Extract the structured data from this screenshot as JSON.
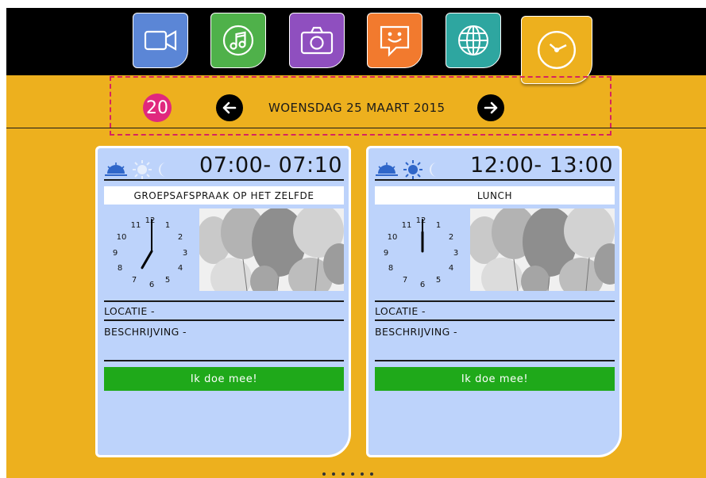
{
  "apps": [
    {
      "name": "video",
      "icon": "video-camera-icon",
      "color": "#5b86d6"
    },
    {
      "name": "music",
      "icon": "music-note-icon",
      "color": "#4fb14a"
    },
    {
      "name": "photo",
      "icon": "camera-icon",
      "color": "#8f4fbf"
    },
    {
      "name": "chat",
      "icon": "chat-smiley-icon",
      "color": "#f27a2e"
    },
    {
      "name": "web",
      "icon": "globe-icon",
      "color": "#2ea6a0"
    },
    {
      "name": "clock",
      "icon": "clock-icon",
      "color": "#edb01e",
      "active": true
    }
  ],
  "date_header": {
    "day_number": "20",
    "date_label": "WOENSDAG 25 MAART 2015",
    "prev_icon": "arrow-left-icon",
    "next_icon": "arrow-right-icon",
    "highlight_color": "#d6245f"
  },
  "cards": [
    {
      "time": "07:00- 07:10",
      "title": "GROEPSAFSPRAAK OP HET ZELFDE",
      "clock": {
        "hour": 7,
        "minute": 0
      },
      "weather": {
        "active": "sunrise",
        "icons": [
          "sunrise-icon",
          "sun-icon",
          "moon-icon"
        ]
      },
      "location_label": "LOCATIE -",
      "description_label": "BESCHRIJVING -",
      "join_label": "Ik doe mee!",
      "image": "balloons-photo"
    },
    {
      "time": "12:00- 13:00",
      "title": "LUNCH",
      "clock": {
        "hour": 12,
        "minute": 0
      },
      "weather": {
        "active": "sun",
        "icons": [
          "sunrise-icon",
          "sun-icon",
          "moon-icon"
        ]
      },
      "location_label": "LOCATIE -",
      "description_label": "BESCHRIJVING -",
      "join_label": "Ik doe mee!",
      "image": "balloons-photo"
    }
  ],
  "clock_numbers": [
    "12",
    "1",
    "2",
    "3",
    "4",
    "5",
    "6",
    "7",
    "8",
    "9",
    "10",
    "11"
  ],
  "pagination": {
    "pages": 6,
    "current": 1
  },
  "colors": {
    "background": "#edb01e",
    "topbar": "#000000",
    "card": "#bdd3fb",
    "join_button": "#1fa91a",
    "day_badge": "#e0287e"
  }
}
